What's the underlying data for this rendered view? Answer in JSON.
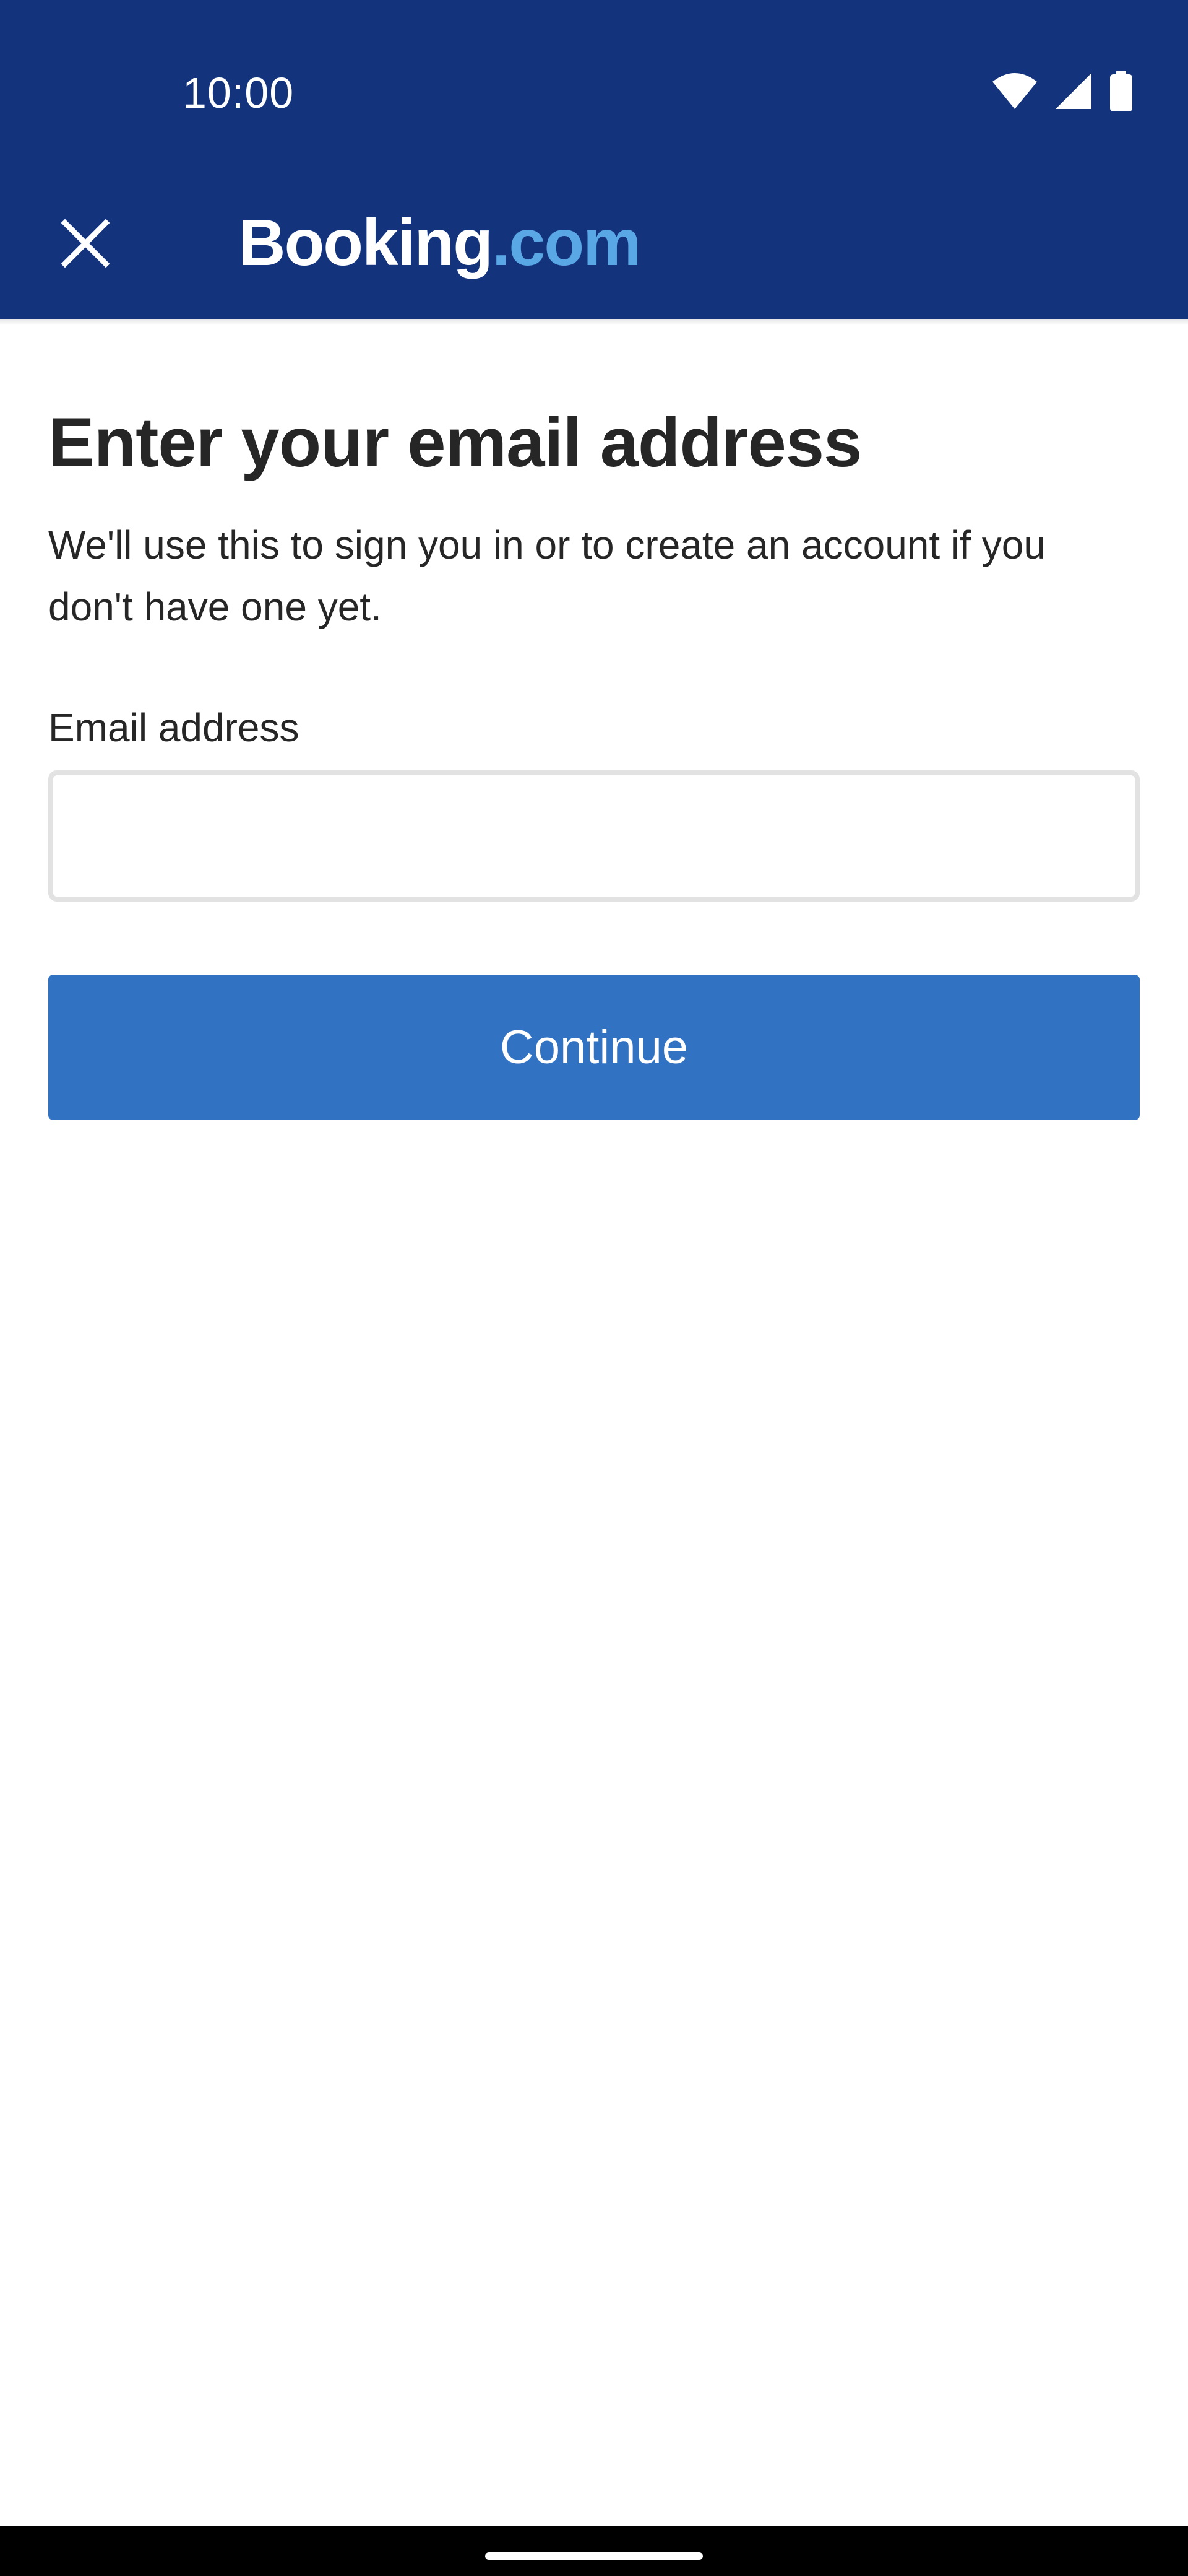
{
  "status_bar": {
    "time": "10:00",
    "icons": [
      "wifi-icon",
      "cellular-signal-icon",
      "battery-icon"
    ]
  },
  "app_bar": {
    "close_icon": "close-icon",
    "brand": {
      "primary": "Booking",
      "suffix": ".com"
    }
  },
  "main": {
    "title": "Enter your email address",
    "subtitle": "We'll use this to sign you in or to create an account if you don't have one yet.",
    "email_label": "Email address",
    "email_value": "",
    "continue_label": "Continue"
  },
  "colors": {
    "header_bg": "#13347D",
    "brand_suffix": "#5AA7E6",
    "primary_button": "#3172C2",
    "input_border": "#E2E2E2"
  }
}
